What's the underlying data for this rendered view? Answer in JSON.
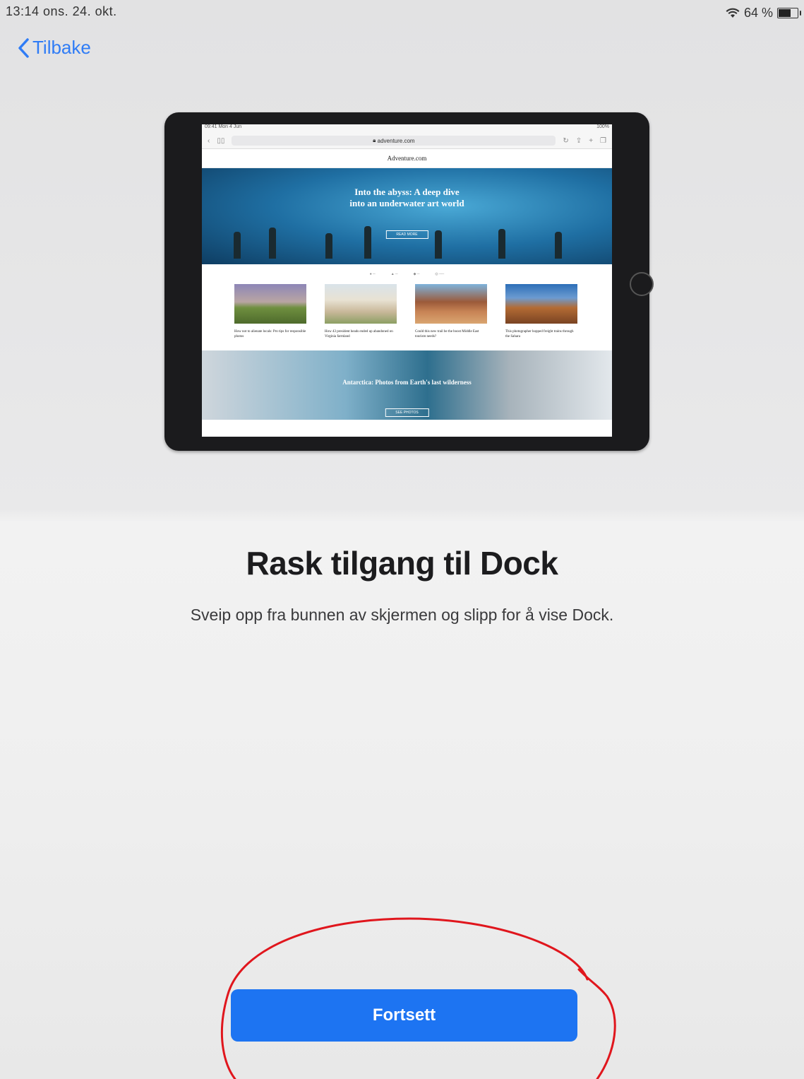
{
  "status": {
    "time_date": "13:14  ons. 24. okt.",
    "battery": "64 %"
  },
  "nav": {
    "back_label": "Tilbake"
  },
  "illustration": {
    "status_time": "09:41  Mon 4 Jun",
    "status_battery": "100%",
    "url": "adventure.com",
    "site_name": "Adventure.com",
    "hero_title_1": "Into the abyss: A deep dive",
    "hero_title_2": "into an underwater art world",
    "hero_button": "READ MORE",
    "cards": [
      "How not to alienate locals: Pro tips for responsible photos",
      "How 43 president heads ended up abandoned on Virginia farmland",
      "Could this new trail be the boost Middle East tourism needs?",
      "This photographer hopped freight trains through the Sahara"
    ],
    "band_title": "Antarctica: Photos from Earth's last wilderness",
    "band_button": "SEE PHOTOS"
  },
  "main": {
    "title": "Rask tilgang til Dock",
    "subtitle": "Sveip opp fra bunnen av skjermen og slipp for å vise Dock.",
    "continue_label": "Fortsett"
  },
  "colors": {
    "accent": "#1d74f2",
    "link": "#2f7cf6",
    "annotation": "#e0161d"
  }
}
